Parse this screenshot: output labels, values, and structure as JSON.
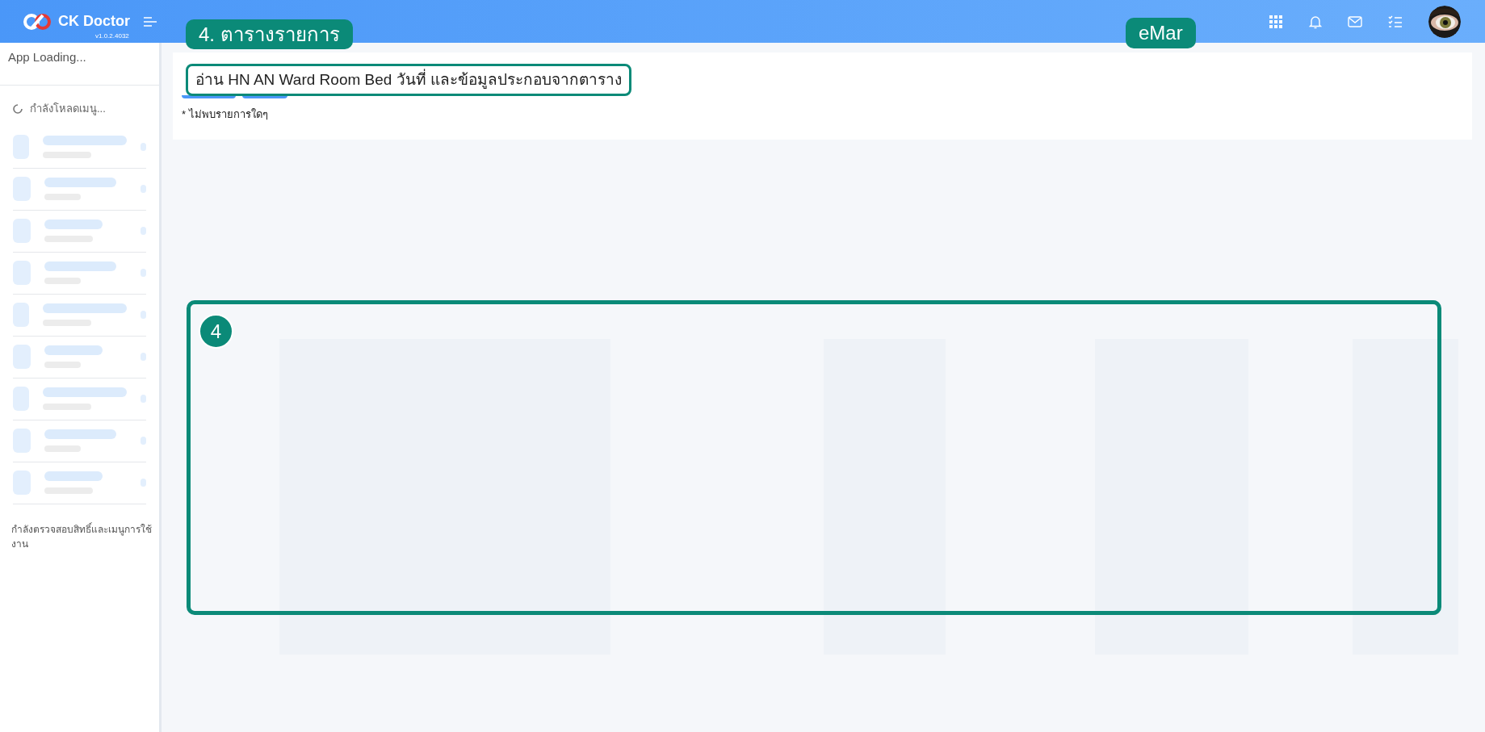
{
  "header": {
    "logo_text": "CK Doctor",
    "version": "v1.0.2.4032"
  },
  "sidebar": {
    "title": "App Loading...",
    "menu_loading": "กำลังโหลดเมนู...",
    "footer": "กำลังตรวจสอบสิทธิ์และเมนูการใช้งาน"
  },
  "content": {
    "empty_note": "* ไม่พบรายการใดๆ"
  },
  "annotations": [
    {
      "kind": "tag",
      "text": "4. ตารางรายการ"
    },
    {
      "kind": "tag",
      "text": "eMar"
    },
    {
      "kind": "callout",
      "text": "อ่าน HN AN Ward Room Bed วันที่ และข้อมูลประกอบจากตาราง"
    },
    {
      "kind": "region",
      "text": "4"
    }
  ]
}
